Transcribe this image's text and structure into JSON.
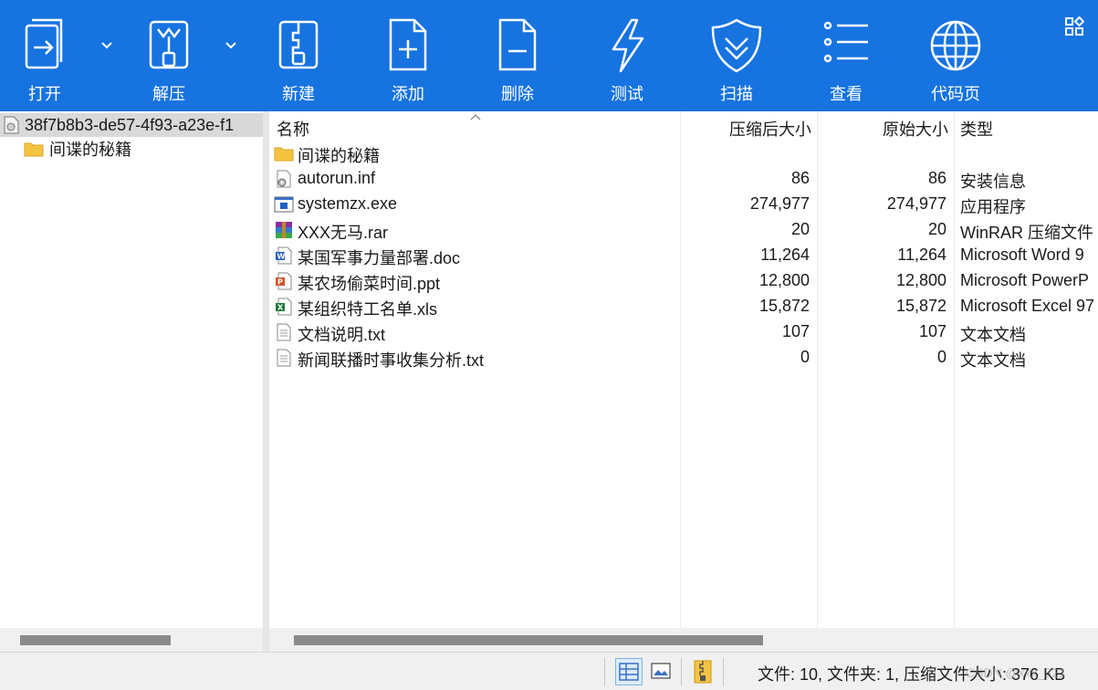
{
  "toolbar": {
    "buttons": [
      {
        "label": "打开",
        "icon": "open-icon"
      },
      {
        "label": "解压",
        "icon": "extract-icon"
      },
      {
        "label": "新建",
        "icon": "new-archive-icon"
      },
      {
        "label": "添加",
        "icon": "add-file-icon"
      },
      {
        "label": "删除",
        "icon": "delete-file-icon"
      },
      {
        "label": "测试",
        "icon": "test-lightning-icon"
      },
      {
        "label": "扫描",
        "icon": "scan-shield-icon"
      },
      {
        "label": "查看",
        "icon": "view-list-icon"
      },
      {
        "label": "代码页",
        "icon": "codepage-globe-icon"
      }
    ],
    "accent": "#1673e0"
  },
  "tree": {
    "root": "38f7b8b3-de57-4f93-a23e-f1",
    "child": "间谍的秘籍"
  },
  "list": {
    "headers": {
      "name": "名称",
      "csize": "压缩后大小",
      "osize": "原始大小",
      "type": "类型"
    },
    "rows": [
      {
        "name": "间谍的秘籍",
        "csize": "",
        "osize": "",
        "type": "",
        "icon": "folder-icon"
      },
      {
        "name": "autorun.inf",
        "csize": "86",
        "osize": "86",
        "type": "安装信息",
        "icon": "inf-file-icon"
      },
      {
        "name": "systemzx.exe",
        "csize": "274,977",
        "osize": "274,977",
        "type": "应用程序",
        "icon": "exe-file-icon"
      },
      {
        "name": "XXX无马.rar",
        "csize": "20",
        "osize": "20",
        "type": "WinRAR 压缩文件",
        "icon": "rar-file-icon"
      },
      {
        "name": "某国军事力量部署.doc",
        "csize": "11,264",
        "osize": "11,264",
        "type": "Microsoft Word 9",
        "icon": "word-file-icon"
      },
      {
        "name": "某农场偷菜时间.ppt",
        "csize": "12,800",
        "osize": "12,800",
        "type": "Microsoft PowerP",
        "icon": "ppt-file-icon"
      },
      {
        "name": "某组织特工名单.xls",
        "csize": "15,872",
        "osize": "15,872",
        "type": "Microsoft Excel 97",
        "icon": "excel-file-icon"
      },
      {
        "name": "文档说明.txt",
        "csize": "107",
        "osize": "107",
        "type": "文本文档",
        "icon": "text-file-icon"
      },
      {
        "name": "新闻联播时事收集分析.txt",
        "csize": "0",
        "osize": "0",
        "type": "文本文档",
        "icon": "text-file-icon"
      }
    ]
  },
  "status": {
    "summary": "文件: 10, 文件夹: 1, 压缩文件大小: 376 KB",
    "watermark": "CSDN @xxx_321"
  }
}
